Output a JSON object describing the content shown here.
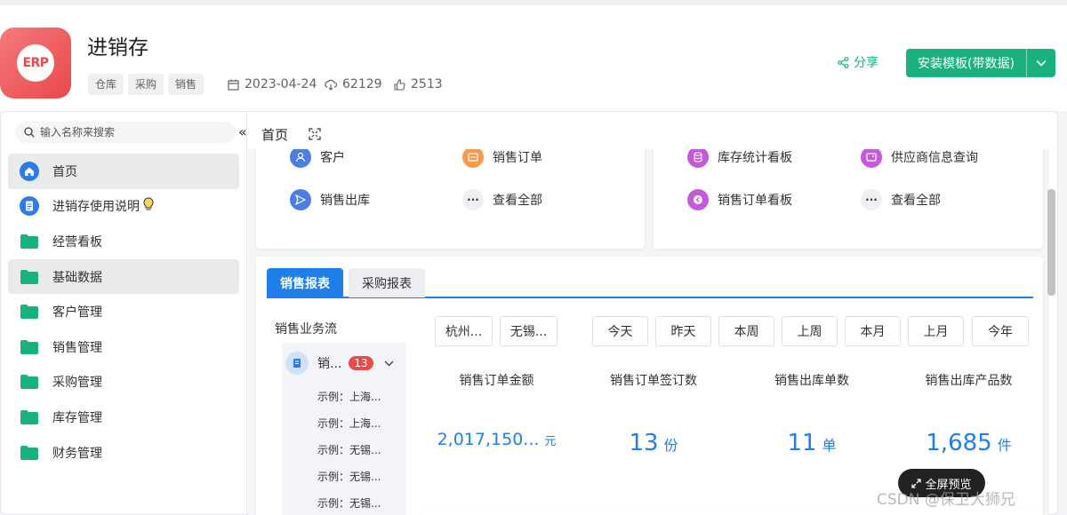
{
  "header": {
    "logo_text": "ERP",
    "title": "进销存",
    "tags": [
      "仓库",
      "采购",
      "销售"
    ],
    "date": "2023-04-24",
    "downloads": "62129",
    "likes": "2513",
    "share_label": "分享",
    "install_label": "安装模板(带数据)",
    "accent_color": "#19b27c"
  },
  "sidebar": {
    "search_placeholder": "输入名称来搜索",
    "items": [
      {
        "label": "首页",
        "icon": "home-icon"
      },
      {
        "label": "进销存使用说明",
        "icon": "document-icon"
      },
      {
        "label": "经营看板",
        "icon": "folder-icon"
      },
      {
        "label": "基础数据",
        "icon": "folder-icon"
      },
      {
        "label": "客户管理",
        "icon": "folder-icon"
      },
      {
        "label": "销售管理",
        "icon": "folder-icon"
      },
      {
        "label": "采购管理",
        "icon": "folder-icon"
      },
      {
        "label": "库存管理",
        "icon": "folder-icon"
      },
      {
        "label": "财务管理",
        "icon": "folder-icon"
      }
    ]
  },
  "breadcrumb": {
    "current": "首页"
  },
  "quick_left": [
    {
      "label": "客户",
      "icon": "customer-icon",
      "color": "#4a7fe0"
    },
    {
      "label": "销售订单",
      "icon": "order-icon",
      "color": "#f59a4c"
    },
    {
      "label": "销售出库",
      "icon": "send-icon",
      "color": "#4a7fe0"
    },
    {
      "label": "查看全部",
      "icon": "more-icon",
      "color": "#eef0f3"
    }
  ],
  "quick_right": [
    {
      "label": "库存统计看板",
      "icon": "database-icon",
      "color": "#c45ad8"
    },
    {
      "label": "供应商信息查询",
      "icon": "image-icon",
      "color": "#c45ad8"
    },
    {
      "label": "销售订单看板",
      "icon": "back-icon",
      "color": "#c45ad8"
    },
    {
      "label": "查看全部",
      "icon": "more-icon",
      "color": "#eef0f3"
    }
  ],
  "tabs": [
    {
      "label": "销售报表",
      "active": true
    },
    {
      "label": "采购报表",
      "active": false
    }
  ],
  "flow": {
    "title": "销售业务流",
    "item_label": "销...",
    "badge": "13",
    "subitems": [
      "示例：上海...",
      "示例：上海...",
      "示例：无锡...",
      "示例：无锡...",
      "示例：无锡..."
    ]
  },
  "filters": {
    "regions": [
      "杭州...",
      "无锡..."
    ],
    "periods": [
      "今天",
      "昨天",
      "本周",
      "上周",
      "本月",
      "上月",
      "今年"
    ]
  },
  "stats": [
    {
      "label": "销售订单金额",
      "value": "2,017,150...",
      "unit": "元"
    },
    {
      "label": "销售订单签订数",
      "value": "13",
      "unit": "份"
    },
    {
      "label": "销售出库单数",
      "value": "11",
      "unit": "单"
    },
    {
      "label": "销售出库产品数",
      "value": "1,685",
      "unit": "件"
    }
  ],
  "fullscreen_label": "全屏预览",
  "watermark": "CSDN @保卫大狮兄"
}
